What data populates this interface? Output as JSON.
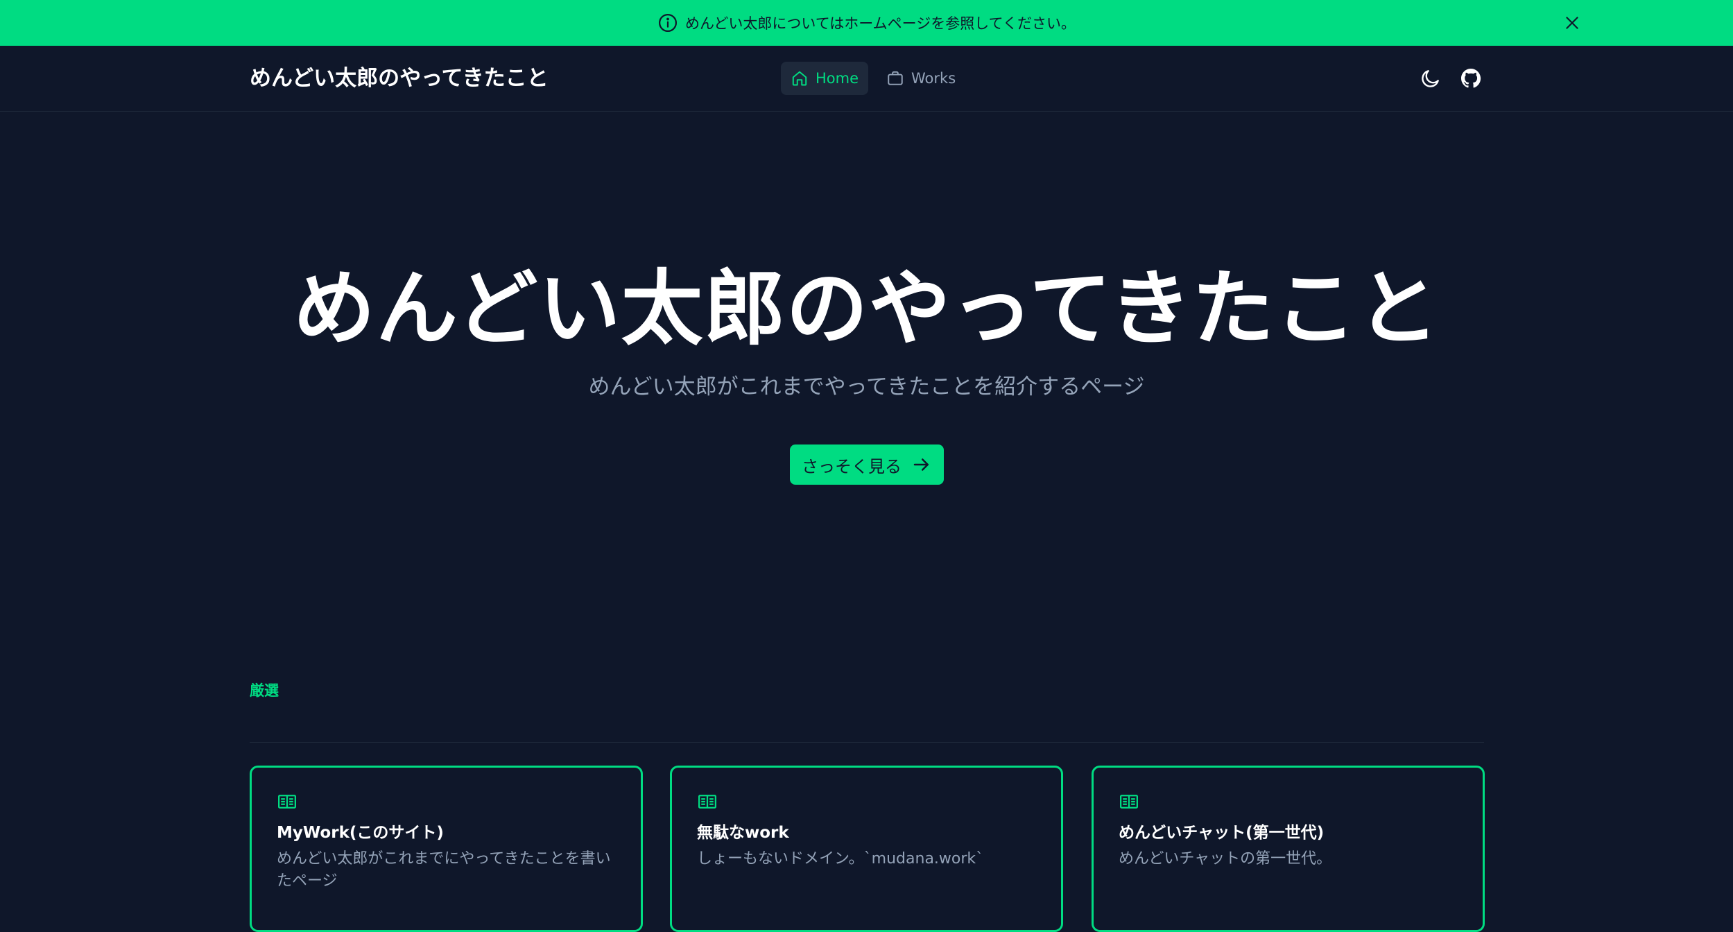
{
  "banner": {
    "text": "めんどい太郎についてはホームページを参照してください。"
  },
  "header": {
    "brand": "めんどい太郎のやってきたこと",
    "nav": [
      {
        "label": "Home",
        "icon": "home-icon",
        "active": true
      },
      {
        "label": "Works",
        "icon": "briefcase-icon",
        "active": false
      }
    ],
    "actions": [
      "moon-icon",
      "github-icon"
    ]
  },
  "hero": {
    "title": "めんどい太郎のやってきたこと",
    "subtitle": "めんどい太郎がこれまでやってきたことを紹介するページ",
    "cta_label": "さっそく見る"
  },
  "featured": {
    "label": "厳選",
    "cards": [
      {
        "title": "MyWork(このサイト)",
        "description": "めんどい太郎がこれまでにやってきたことを書いたページ",
        "icon": "book-open-icon"
      },
      {
        "title": "無駄なwork",
        "description": "しょーもないドメイン。`mudana.work`",
        "icon": "book-open-icon"
      },
      {
        "title": "めんどいチャット(第一世代)",
        "description": "めんどいチャットの第一世代。",
        "icon": "book-open-icon"
      }
    ]
  },
  "colors": {
    "accent": "#00dc82",
    "background": "#0f172a",
    "muted_text": "#94a3b8",
    "border": "#1e293b"
  }
}
